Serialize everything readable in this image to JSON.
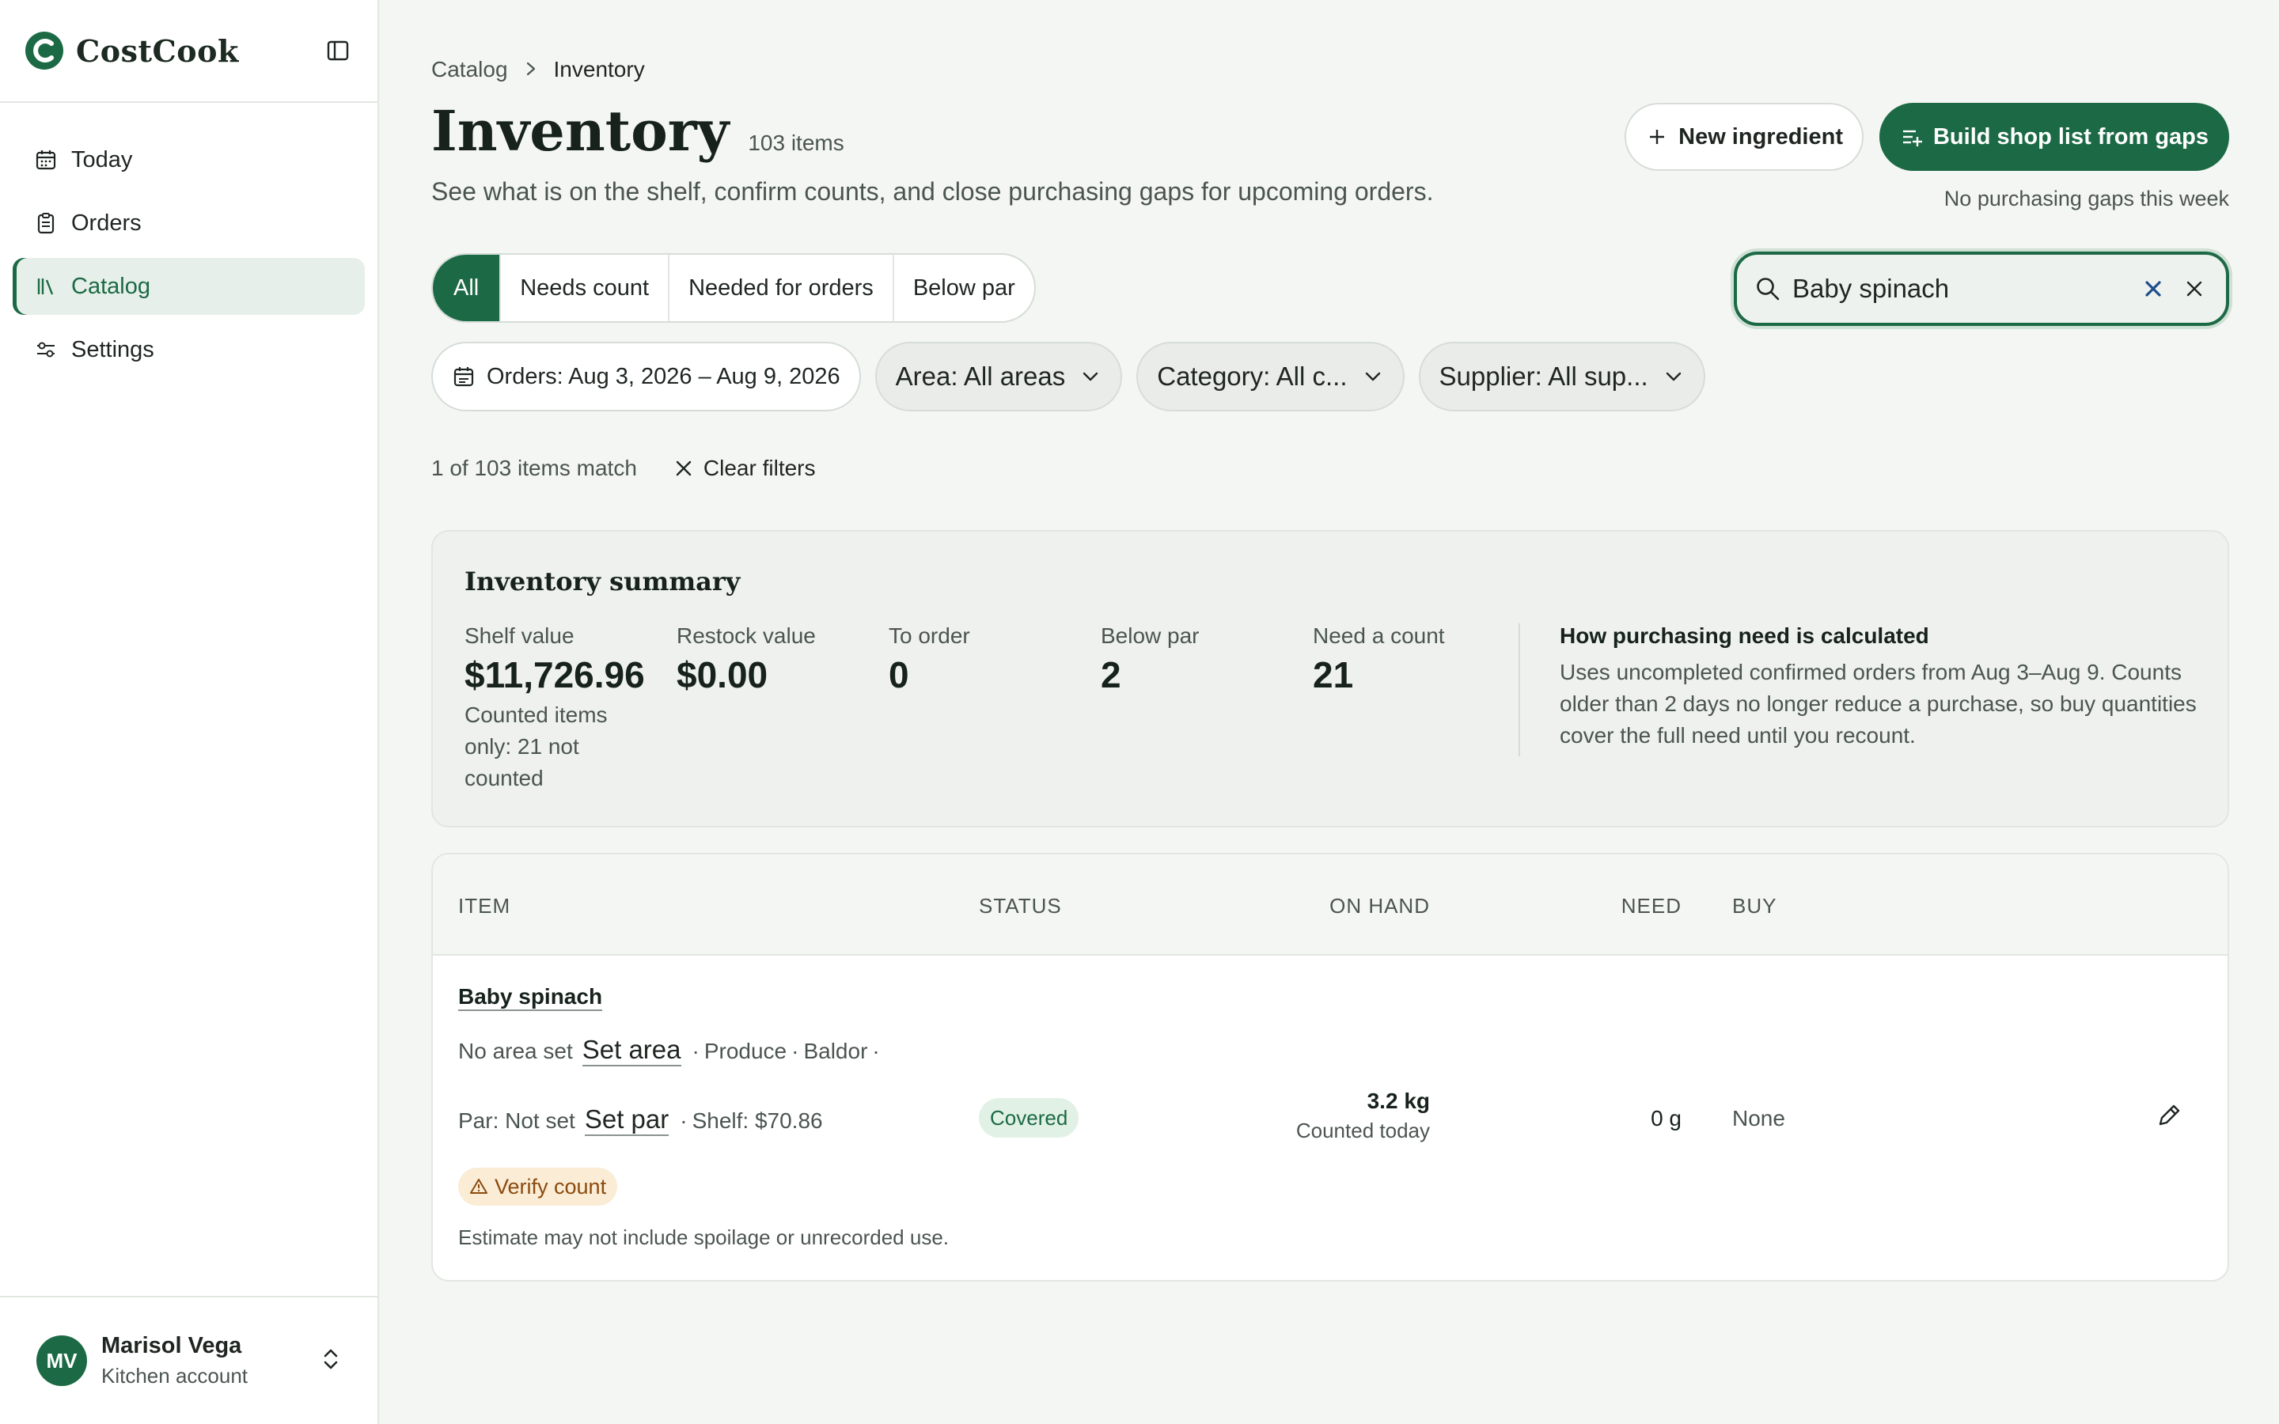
{
  "app": {
    "name": "CostCook"
  },
  "sidebar": {
    "items": [
      {
        "label": "Today",
        "icon": "calendar-icon"
      },
      {
        "label": "Orders",
        "icon": "clipboard-icon"
      },
      {
        "label": "Catalog",
        "icon": "books-icon",
        "active": true
      },
      {
        "label": "Settings",
        "icon": "sliders-icon"
      }
    ],
    "account": {
      "initials": "MV",
      "name": "Marisol Vega",
      "role": "Kitchen account"
    }
  },
  "breadcrumb": {
    "parent": "Catalog",
    "current": "Inventory"
  },
  "header": {
    "title": "Inventory",
    "count": "103 items",
    "subtitle": "See what is on the shelf, confirm counts, and close purchasing gaps for upcoming orders.",
    "new_label": "New ingredient",
    "build_label": "Build shop list from gaps",
    "gaps_note": "No purchasing gaps this week"
  },
  "tabs": [
    {
      "label": "All",
      "active": true
    },
    {
      "label": "Needs count"
    },
    {
      "label": "Needed for orders"
    },
    {
      "label": "Below par"
    }
  ],
  "search": {
    "value": "Baby spinach"
  },
  "filters": {
    "date": "Orders: Aug 3, 2026 – Aug 9, 2026",
    "area": "Area: All areas",
    "category": "Category: All c...",
    "supplier": "Supplier: All sup..."
  },
  "results": {
    "match_text": "1 of 103 items match",
    "clear_label": "Clear filters"
  },
  "summary": {
    "title": "Inventory summary",
    "metrics": [
      {
        "label": "Shelf value",
        "value": "$11,726.96",
        "note": "Counted items only: 21 not counted"
      },
      {
        "label": "Restock value",
        "value": "$0.00"
      },
      {
        "label": "To order",
        "value": "0"
      },
      {
        "label": "Below par",
        "value": "2"
      },
      {
        "label": "Need a count",
        "value": "21"
      }
    ],
    "calc_title": "How purchasing need is calculated",
    "calc_body": "Uses uncompleted confirmed orders from Aug 3–Aug 9. Counts older than 2 days no longer reduce a purchase, so buy quantities cover the full need until you recount."
  },
  "table": {
    "columns": [
      "ITEM",
      "STATUS",
      "ON HAND",
      "NEED",
      "BUY"
    ],
    "rows": [
      {
        "name": "Baby spinach",
        "area": "No area set",
        "set_area": "Set area",
        "category": "Produce",
        "supplier": "Baldor",
        "par": "Par: Not set",
        "set_par": "Set par",
        "shelf": "Shelf: $70.86",
        "warning": "Verify count",
        "estimate": "Estimate may not include spoilage or unrecorded use.",
        "status": "Covered",
        "on_hand": "3.2 kg",
        "counted": "Counted today",
        "need": "0 g",
        "buy": "None"
      }
    ]
  },
  "colors": {
    "accent": "#1c6a45",
    "warning_bg": "#fbecd6",
    "status_bg": "#e2f1e6"
  }
}
